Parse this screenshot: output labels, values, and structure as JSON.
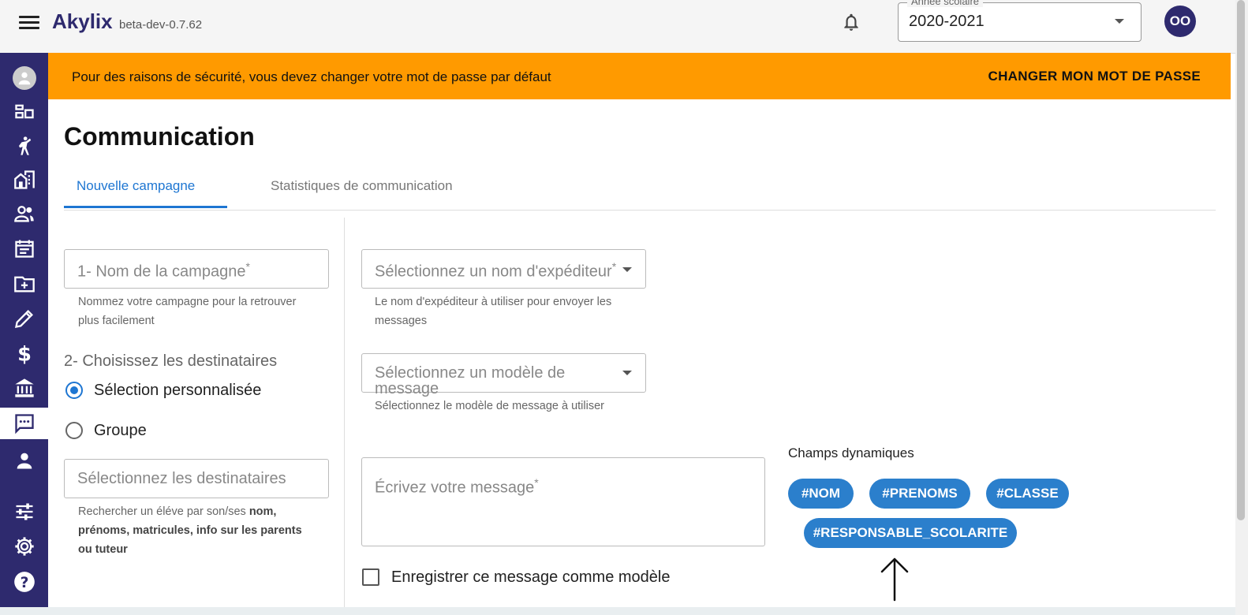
{
  "header": {
    "brand": "Akylix",
    "version": "beta-dev-0.7.62",
    "year_label": "Année scolaire",
    "year_value": "2020-2021",
    "user_initials": "OO"
  },
  "banner": {
    "text": "Pour des raisons de sécurité, vous devez changer votre mot de passe par défaut",
    "action": "CHANGER MON MOT DE PASSE"
  },
  "page": {
    "title": "Communication",
    "tabs": [
      "Nouvelle campagne",
      "Statistiques de communication"
    ],
    "active_tab": "Nouvelle campagne"
  },
  "form": {
    "campaign_name_placeholder": "1- Nom de la campagne",
    "campaign_name_help": "Nommez votre campagne pour la retrouver plus facilement",
    "recipients_label": "2- Choisissez les destinataires",
    "radio_custom": "Sélection personnalisée",
    "radio_group": "Groupe",
    "recipients_placeholder": "Sélectionnez les destinataires",
    "recipients_help_prefix": "Rechercher un éléve par son/ses",
    "recipients_help_bold": "nom, prénoms, matricules, info sur les parents ou tuteur",
    "sender_placeholder": "Sélectionnez un nom d'expéditeur",
    "sender_help": "Le nom d'expéditeur à utiliser pour envoyer les messages",
    "template_placeholder_1": "Sélectionnez un modèle de",
    "template_placeholder_2": "message",
    "template_help": "Sélectionnez le modèle de message à utiliser",
    "message_placeholder": "Écrivez votre message",
    "save_template_label": "Enregistrer ce message comme modèle",
    "required_mark": "*"
  },
  "dynamic_fields": {
    "title": "Champs dynamiques",
    "chips": [
      "#NOM",
      "#PRENOMS",
      "#CLASSE",
      "#RESPONSABLE_SCOLARITE"
    ]
  },
  "colors": {
    "sidebar": "#2e2a6e",
    "banner": "#ff9a00",
    "accent": "#1e76d2",
    "chip": "#2b7fcc"
  },
  "sidebar_icons": [
    "profile-icon",
    "dashboard-icon",
    "student-icon",
    "school-icon",
    "people-icon",
    "calendar-icon",
    "folder-add-icon",
    "pencil-icon",
    "dollar-icon",
    "bank-icon",
    "chat-icon",
    "person-icon",
    "sliders-icon",
    "gear-icon",
    "help-icon"
  ],
  "active_sidebar_item": "chat-icon"
}
